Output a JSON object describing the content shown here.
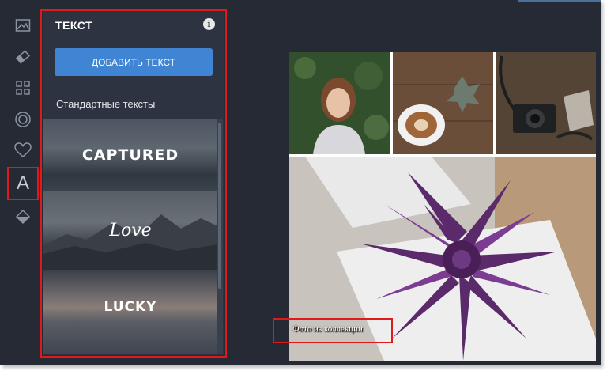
{
  "panel": {
    "title": "ТЕКСТ",
    "info_icon": "info-icon",
    "add_button": "Добавить текст",
    "section_label": "Стандартные тексты",
    "presets": [
      "CAPTURED",
      "Love",
      "LUCKY"
    ]
  },
  "rail": {
    "icons": [
      "image-icon",
      "eraser-icon",
      "grid-icon",
      "circle-frame-icon",
      "heart-icon",
      "text-icon",
      "fill-icon"
    ],
    "text_glyph": "A"
  },
  "canvas": {
    "caption": "Фото из коллекции"
  },
  "colors": {
    "background": "#252a34",
    "panel": "#2d3340",
    "accent": "#3f85d3",
    "highlight": "#e01a1a"
  }
}
